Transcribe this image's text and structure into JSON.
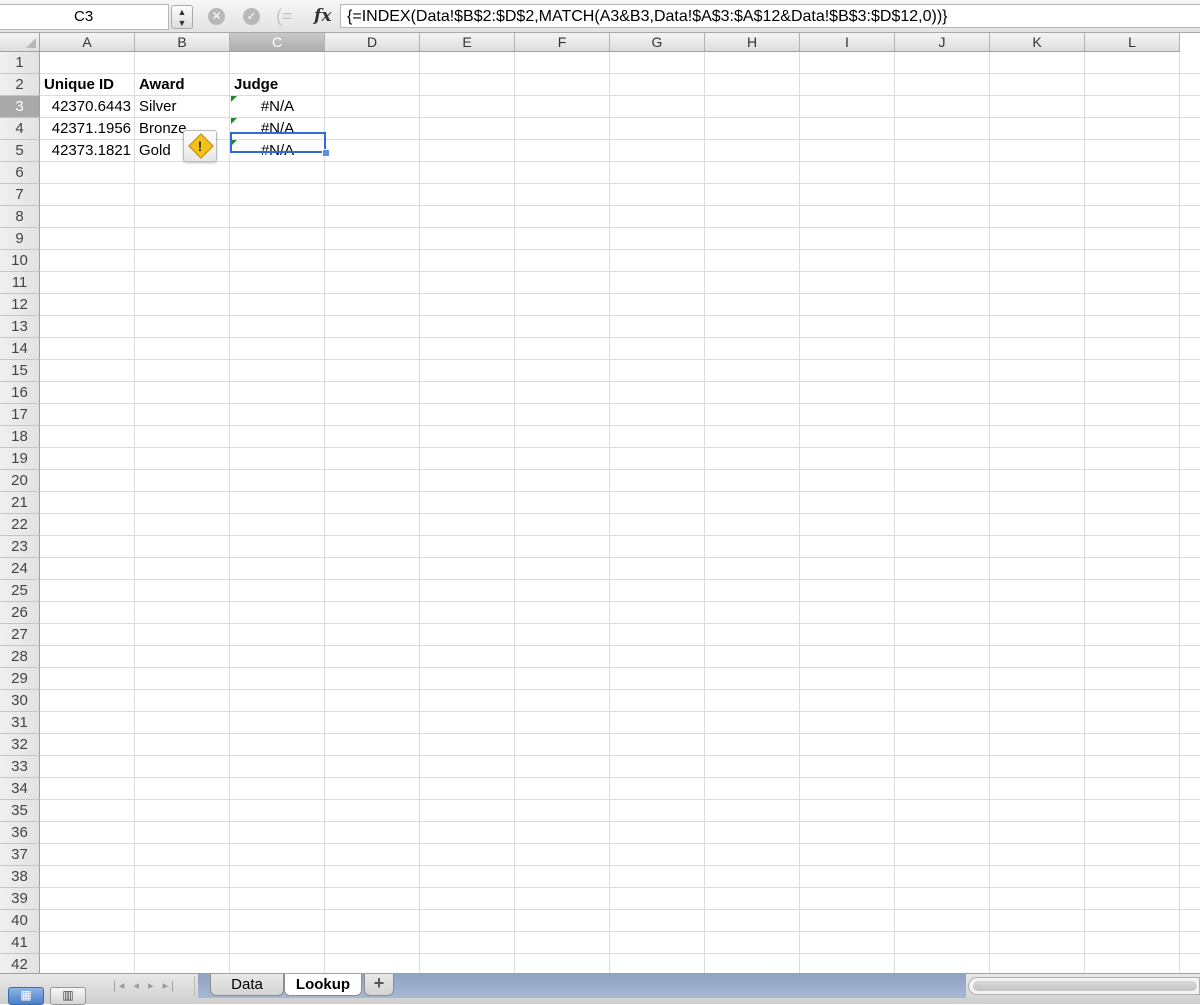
{
  "formula_bar": {
    "name_box": "C3",
    "cancel_icon": "cancel-icon",
    "enter_icon": "enter-icon",
    "fx_label": "fx",
    "formula": "{=INDEX(Data!$B$2:$D$2,MATCH(A3&B3,Data!$A$3:$A$12&Data!$B$3:$D$12,0))}"
  },
  "columns": [
    "A",
    "B",
    "C",
    "D",
    "E",
    "F",
    "G",
    "H",
    "I",
    "J",
    "K",
    "L"
  ],
  "selected_column": "C",
  "selected_row": 3,
  "rows": [
    "1",
    "2",
    "3",
    "4",
    "5",
    "6",
    "7",
    "8",
    "9",
    "10",
    "11",
    "12",
    "13",
    "14",
    "15",
    "16",
    "17",
    "18",
    "19",
    "20",
    "21",
    "22",
    "23",
    "24",
    "25",
    "26",
    "27",
    "28",
    "29",
    "30",
    "31",
    "32",
    "33",
    "34",
    "35",
    "36",
    "37",
    "38",
    "39",
    "40",
    "41",
    "42"
  ],
  "cells": {
    "A2": "Unique ID",
    "B2": "Award",
    "C2": "Judge",
    "A3": "42370.6443",
    "B3": "Silver",
    "C3": "#N/A",
    "A4": "42371.1956",
    "B4": "Bronze",
    "C4": "#N/A",
    "A5": "42373.1821",
    "B5": "Gold",
    "C5": "#N/A"
  },
  "error_indicator_icon": "warning-icon",
  "error_indicator_mark": "!",
  "bottom_bar": {
    "view_normal_icon": "normal-view-icon",
    "view_layout_icon": "page-layout-view-icon",
    "tab_nav": "|◂ ◂ ▸ ▸|",
    "tabs": [
      "Data",
      "Lookup"
    ],
    "active_tab": "Lookup",
    "add_tab": "+"
  },
  "colors": {
    "selection": "#2f6ad8",
    "error_triangle": "#1f8a2a",
    "warning": "#f2c21b"
  }
}
